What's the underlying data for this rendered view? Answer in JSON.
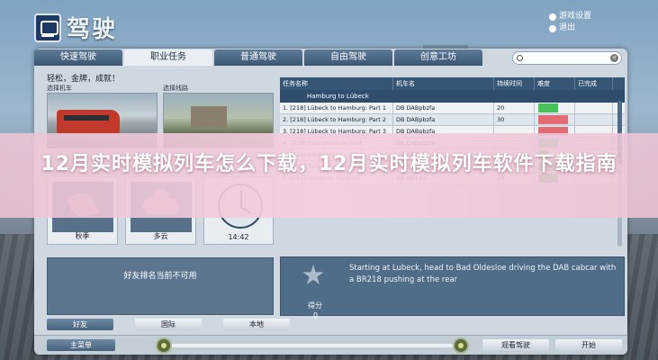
{
  "app": {
    "title": "驾驶"
  },
  "top_links": [
    "游戏设置",
    "退出"
  ],
  "tabs": [
    {
      "label": "快速驾驶",
      "active": false
    },
    {
      "label": "职业任务",
      "active": true
    },
    {
      "label": "普通驾驶",
      "active": false
    },
    {
      "label": "自由驾驶",
      "active": false
    },
    {
      "label": "创意工坊",
      "active": false
    }
  ],
  "left": {
    "hint": "轻松，金牌，成就！",
    "select_train_label": "选择机车",
    "select_route_label": "选择线路",
    "season_label": "秋季",
    "weather_label": "多云",
    "time_label": "14:42",
    "friends_message": "好友排名当前不可用",
    "friend_buttons": [
      "好友",
      "国际",
      "本地"
    ]
  },
  "table": {
    "headers": [
      "任务名称",
      "机车名",
      "持续时间",
      "难度",
      "已完成"
    ],
    "group": "Hamburg to Lübeck",
    "rows": [
      {
        "name": "1. [218] Lübeck to Hamburg: Part 1",
        "loco": "DB DABpbzfa",
        "duration": "20",
        "difficulty": 2,
        "done": false
      },
      {
        "name": "2. [218] Lübeck to Hamburg: Part 2",
        "loco": "DB DABpbzfa",
        "duration": "30",
        "difficulty": 3,
        "done": false
      },
      {
        "name": "3. [218] Lübeck to Hamburg: Part 3",
        "loco": "DB DABpbzfa",
        "duration": "",
        "difficulty": 3,
        "done": false
      },
      {
        "name": "4. [218] Bad Oldesloe Start",
        "loco": "DB DABpbzfa",
        "duration": "",
        "difficulty": 2,
        "done": false
      },
      {
        "name": "5. [218] Shunting",
        "loco": "DB BR218",
        "duration": "",
        "difficulty": 1,
        "done": true
      },
      {
        "name": "6. [218] Tanker Training",
        "loco": "DB BR218",
        "duration": "",
        "difficulty": 2,
        "done": false
      },
      {
        "name": "7. [145] Hardship Harbour",
        "loco": "DB BR145",
        "duration": "20",
        "difficulty": 2,
        "done": false
      }
    ]
  },
  "description": {
    "text": "Starting at Lubeck, head to Bad Oldesloe driving the DAB cabcar with a BR218 pushing at the rear",
    "score_label": "得分",
    "score_value": "0"
  },
  "bottom": {
    "main_menu": "主菜单",
    "watch": "观看驾驶",
    "start": "开始"
  },
  "overlay": {
    "title": "12月实时模拟列车怎么下载，12月实时模拟列车软件下载指南"
  },
  "colors": {
    "accent": "#355674",
    "difficulty_easy": "#45c35a",
    "difficulty_hard": "#e36a74",
    "overlay": "#f2cbe0"
  }
}
